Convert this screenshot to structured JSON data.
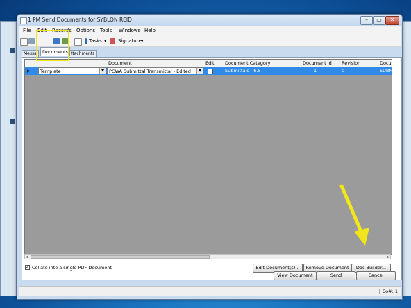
{
  "window": {
    "title": "1 PM Send Documents for SYBLON REID",
    "min": "–",
    "max": "▭",
    "close": "✕"
  },
  "menu": [
    "File",
    "Edit",
    "Records",
    "Options",
    "Tools",
    "Windows",
    "Help"
  ],
  "toolbar": {
    "tasks": "Tasks",
    "signature": "Signature",
    "dropdown_glyph": "▾"
  },
  "tabs": {
    "left": "Messa",
    "active": "Documents",
    "right": "ttachments"
  },
  "grid": {
    "columns": [
      "Document",
      "Edit",
      "Document Category",
      "Document Id",
      "Revision",
      "Docu"
    ],
    "row": {
      "template": "Template",
      "document": "PCWA Submittal Transmittal - Edited",
      "category": "Submittals - 6.5",
      "document_id": "1",
      "revision": "0",
      "extra": "SUBMI"
    }
  },
  "collate": {
    "label": "Collate into a single PDF Document",
    "checked": "✓"
  },
  "panel_buttons": {
    "edit": "Edit Document(s)...",
    "remove": "Remove Document",
    "builder": "Doc Builder..."
  },
  "footer_buttons": {
    "view": "View Document",
    "send": "Send",
    "cancel": "Cancel"
  },
  "status": {
    "co": "Co#: 1"
  },
  "colors": {
    "highlight": "#f1e51c",
    "selected_row": "#2f8ae8",
    "grid_bg": "#9b9b9b"
  }
}
